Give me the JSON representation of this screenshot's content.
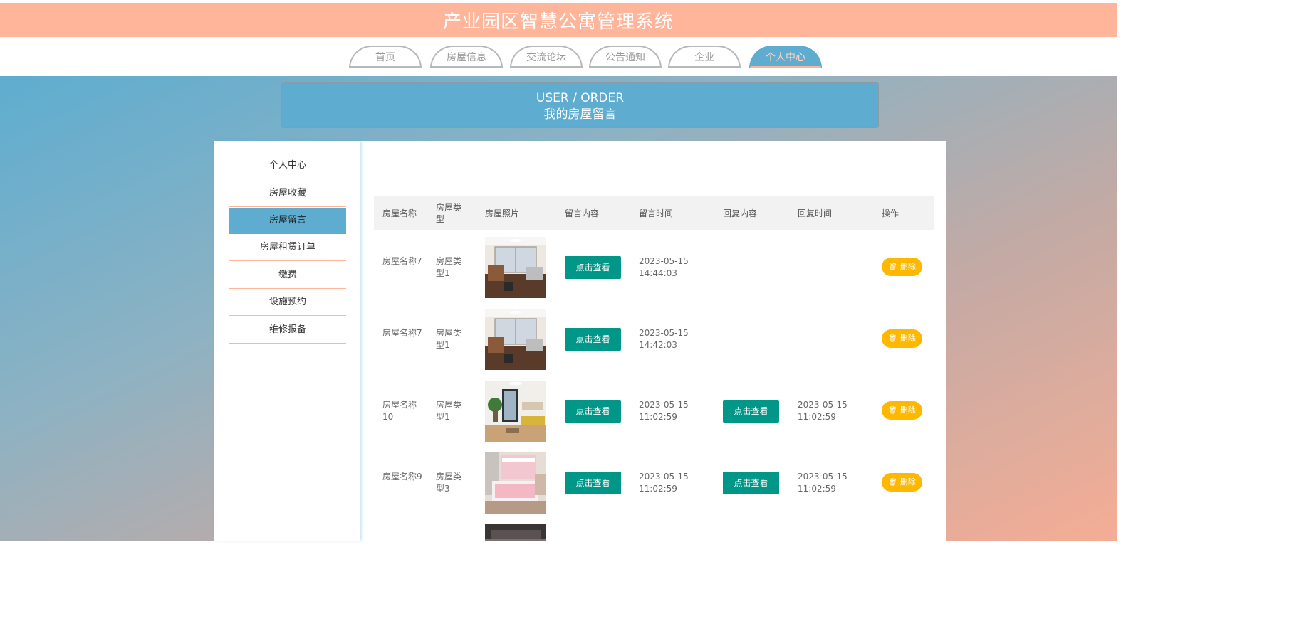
{
  "header": {
    "title": "产业园区智慧公寓管理系统"
  },
  "nav": {
    "tabs": [
      {
        "label": "首页"
      },
      {
        "label": "房屋信息"
      },
      {
        "label": "交流论坛"
      },
      {
        "label": "公告通知"
      },
      {
        "label": "企业"
      },
      {
        "label": "个人中心",
        "active": true
      }
    ]
  },
  "banner": {
    "en": "USER / ORDER",
    "cn": "我的房屋留言"
  },
  "sidebar": {
    "items": [
      {
        "label": "个人中心"
      },
      {
        "label": "房屋收藏"
      },
      {
        "label": "房屋留言",
        "active": true
      },
      {
        "label": "房屋租赁订单"
      },
      {
        "label": "缴费"
      },
      {
        "label": "设施预约"
      },
      {
        "label": "维修报备"
      }
    ]
  },
  "table": {
    "headers": {
      "name": "房屋名称",
      "type": "房屋类型",
      "photo": "房屋照片",
      "content": "留言内容",
      "time": "留言时间",
      "reply": "回复内容",
      "reply_time": "回复时间",
      "op": "操作"
    },
    "view_label": "点击查看",
    "delete_label": "删除",
    "rows": [
      {
        "name": "房屋名称7",
        "type": "房屋类型1",
        "time_date": "2023-05-15",
        "time_clock": "14:44:03",
        "has_reply": false,
        "reply_date": "",
        "reply_clock": ""
      },
      {
        "name": "房屋名称7",
        "type": "房屋类型1",
        "time_date": "2023-05-15",
        "time_clock": "14:42:03",
        "has_reply": false,
        "reply_date": "",
        "reply_clock": ""
      },
      {
        "name": "房屋名称10",
        "type": "房屋类型1",
        "time_date": "2023-05-15",
        "time_clock": "11:02:59",
        "has_reply": true,
        "reply_date": "2023-05-15",
        "reply_clock": "11:02:59"
      },
      {
        "name": "房屋名称9",
        "type": "房屋类型3",
        "time_date": "2023-05-15",
        "time_clock": "11:02:59",
        "has_reply": true,
        "reply_date": "2023-05-15",
        "reply_clock": "11:02:59"
      }
    ]
  },
  "colors": {
    "header_bg": "#ffb59a",
    "accent_blue": "#5eadd0",
    "view_button": "#009688",
    "delete_button": "#ffb800"
  }
}
